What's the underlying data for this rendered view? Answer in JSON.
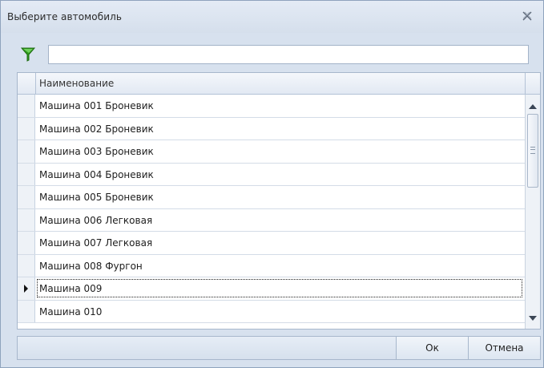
{
  "window": {
    "title": "Выберите автомобиль"
  },
  "filter": {
    "value": "",
    "placeholder": ""
  },
  "grid": {
    "column_header": "Наименование",
    "rows": [
      "Машина 001 Броневик",
      "Машина 002 Броневик",
      "Машина 003 Броневик",
      "Машина 004 Броневик",
      "Машина 005 Броневик",
      "Машина 006 Легковая",
      "Машина 007 Легковая",
      "Машина 008 Фургон",
      "Машина 009",
      "Машина 010"
    ],
    "selected_row": "Машина 009"
  },
  "buttons": {
    "ok": "Ок",
    "cancel": "Отмена"
  },
  "icons": {
    "close": "close-icon",
    "filter": "filter-funnel-icon",
    "row_pointer": "row-pointer-icon",
    "scroll_up": "scroll-up-icon",
    "scroll_down": "scroll-down-icon"
  },
  "colors": {
    "window_bg": "#d7e1ee",
    "filter_icon": "#2e9a1c"
  }
}
